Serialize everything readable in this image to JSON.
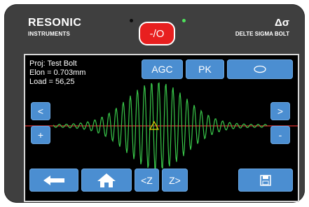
{
  "header": {
    "brand_name": "RESONIC",
    "brand_sub": "INSTRUMENTS",
    "delta_symbol": "Δσ",
    "delta_sub": "DELTE SIGMA BOLT",
    "power_label": "-/O"
  },
  "info": {
    "proj": "Proj: Test Bolt",
    "elon": "Elon = 0.703mm",
    "load": "Load = 56,25"
  },
  "toolbar": {
    "agc": "AGC",
    "pk": "PK"
  },
  "side_buttons": {
    "left_up": "<",
    "left_plus": "+",
    "right_up": ">",
    "right_minus": "-"
  },
  "bottom": {
    "zoom_in": "<Z",
    "zoom_out": "Z>"
  },
  "colors": {
    "screen_bg": "#000000",
    "button": "#4b8ed1",
    "power": "#e81f1f",
    "wave": "#39c84a",
    "axis": "#e03030",
    "marker": "#e6d200"
  }
}
